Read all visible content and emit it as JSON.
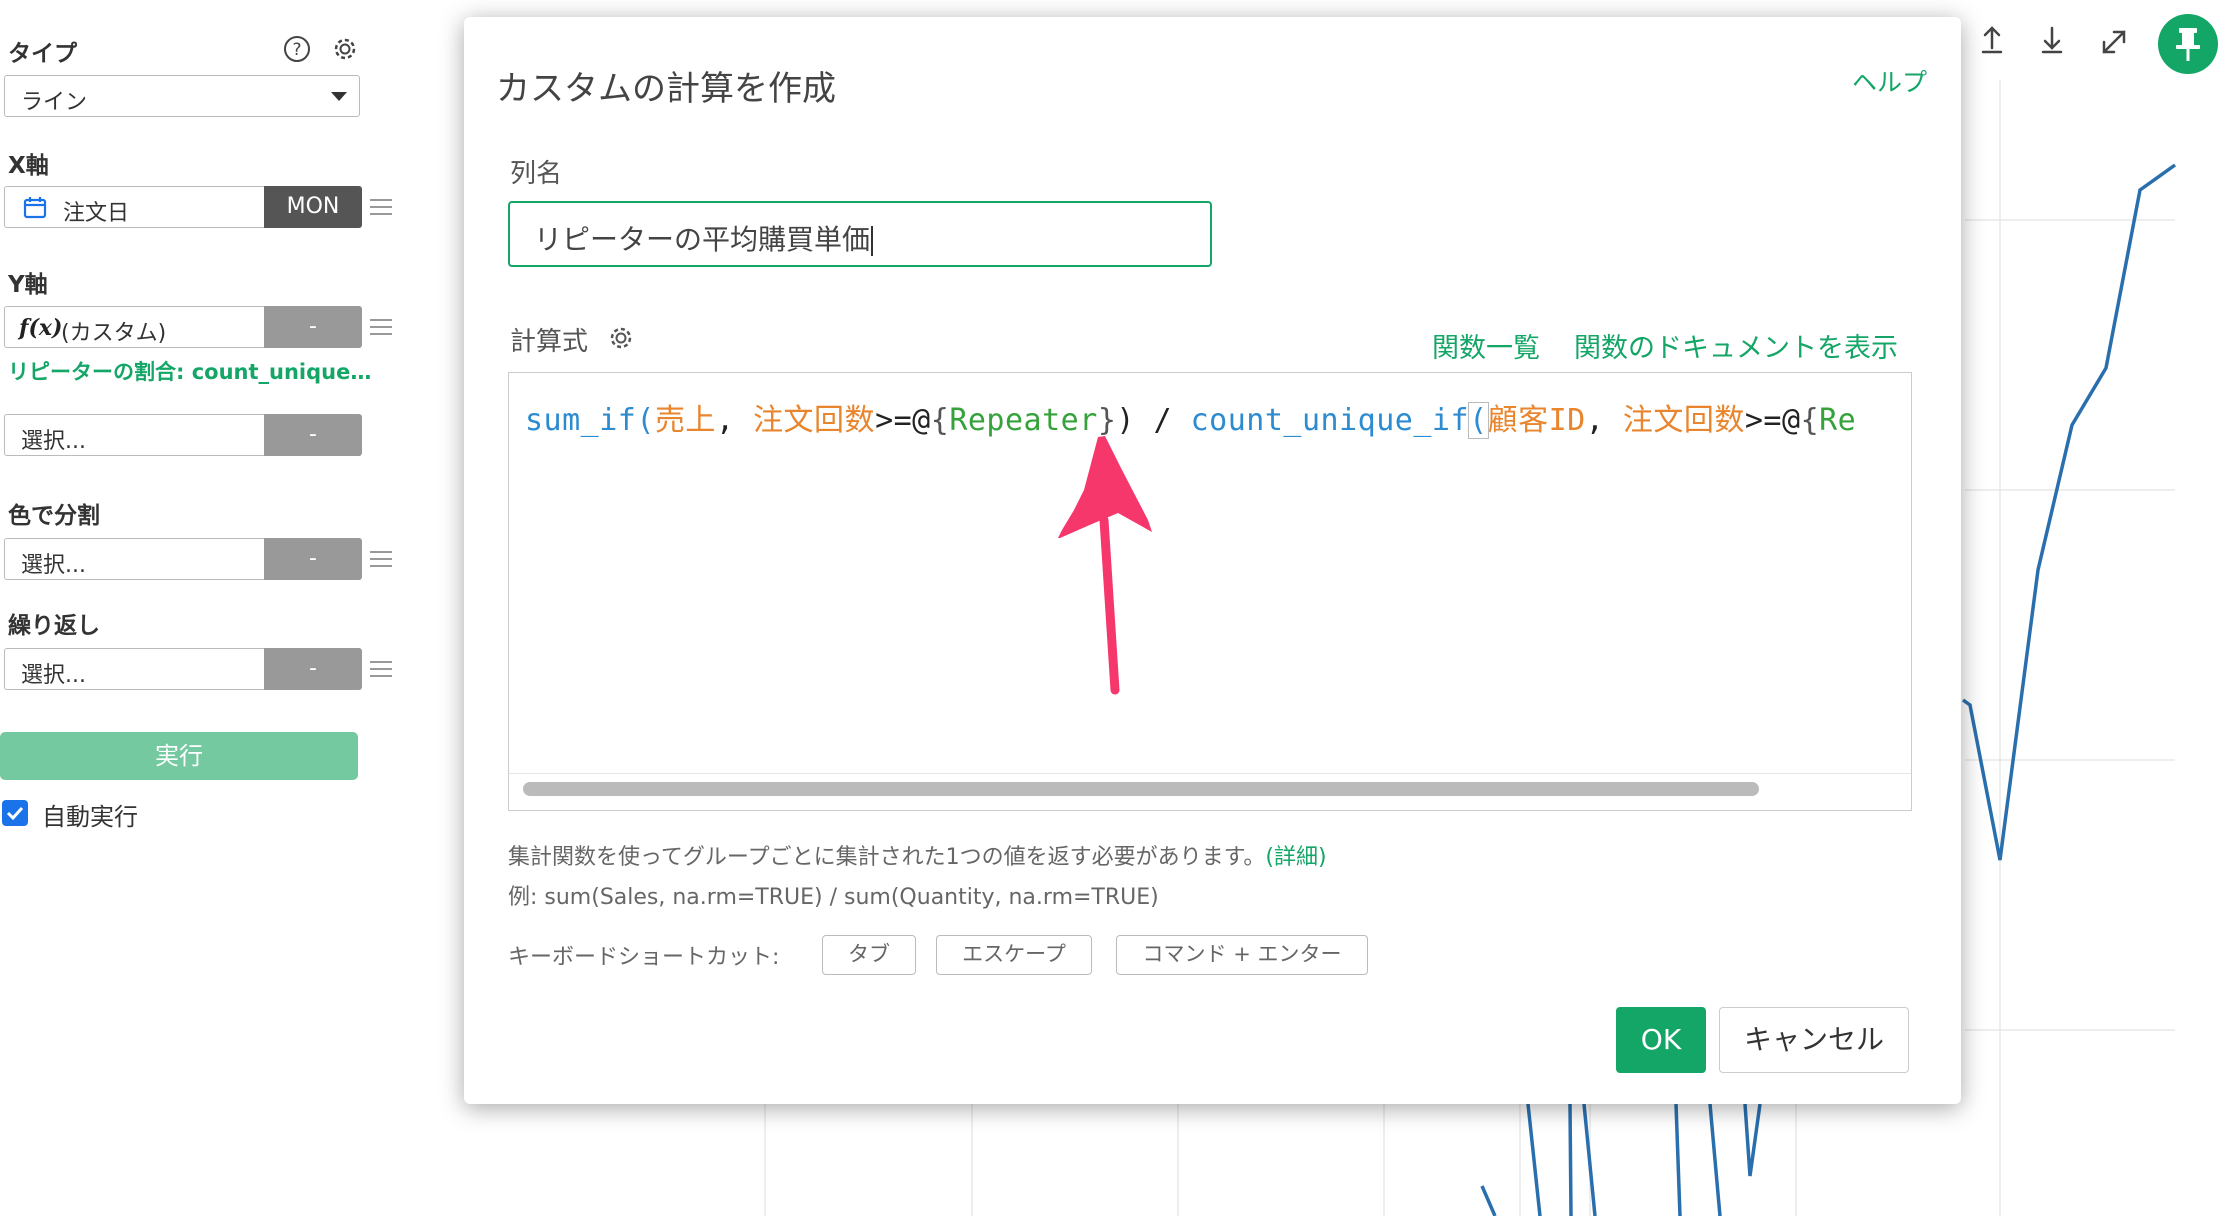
{
  "sidebar": {
    "type_title": "タイプ",
    "type_value": "ライン",
    "x_title": "X軸",
    "x_value": "注文日",
    "x_unit": "MON",
    "y_title": "Y軸",
    "y_value": "(カスタム)",
    "y_fx": "f(x)",
    "y_btn": "-",
    "y_sub": "リピーターの割合: count_unique…",
    "y2_value": "選択...",
    "y2_btn": "-",
    "color_title": "色で分割",
    "color_value": "選択...",
    "color_btn": "-",
    "repeat_title": "繰り返し",
    "repeat_value": "選択...",
    "repeat_btn": "-",
    "run_label": "実行",
    "auto_run_label": "自動実行",
    "auto_run_checked": true
  },
  "modal": {
    "title": "カスタムの計算を作成",
    "help": "ヘルプ",
    "name_label": "列名",
    "name_value": "リピーターの平均購買単価",
    "formula_label": "計算式",
    "func_list_link": "関数一覧",
    "func_doc_link": "関数のドキュメントを表示",
    "code": {
      "t1": "sum_if",
      "t2": "(",
      "t3": "売上",
      "t4": ", ",
      "t5": "注文回数",
      "t6": ">=@",
      "t7": "{",
      "t8": "Repeater",
      "t9": "}",
      "t10": ") / ",
      "t11": "count_unique_if",
      "t12": "(",
      "t13": "顧客ID",
      "t14": ", ",
      "t15": "注文回数",
      "t16": ">=@",
      "t17": "{",
      "t18": "Re"
    },
    "hint1": "集計関数を使ってグループごとに集計された1つの値を返す必要があります。",
    "hint1_link": "(詳細)",
    "hint2": "例: sum(Sales, na.rm=TRUE) / sum(Quantity, na.rm=TRUE)",
    "shortcut_label": "キーボードショートカット:",
    "shortcut_tab": "タブ",
    "shortcut_esc": "エスケープ",
    "shortcut_cmd": "コマンド + エンター",
    "ok": "OK",
    "cancel": "キャンセル"
  },
  "colors": {
    "accent": "#14a667",
    "line": "#2a6fad"
  }
}
